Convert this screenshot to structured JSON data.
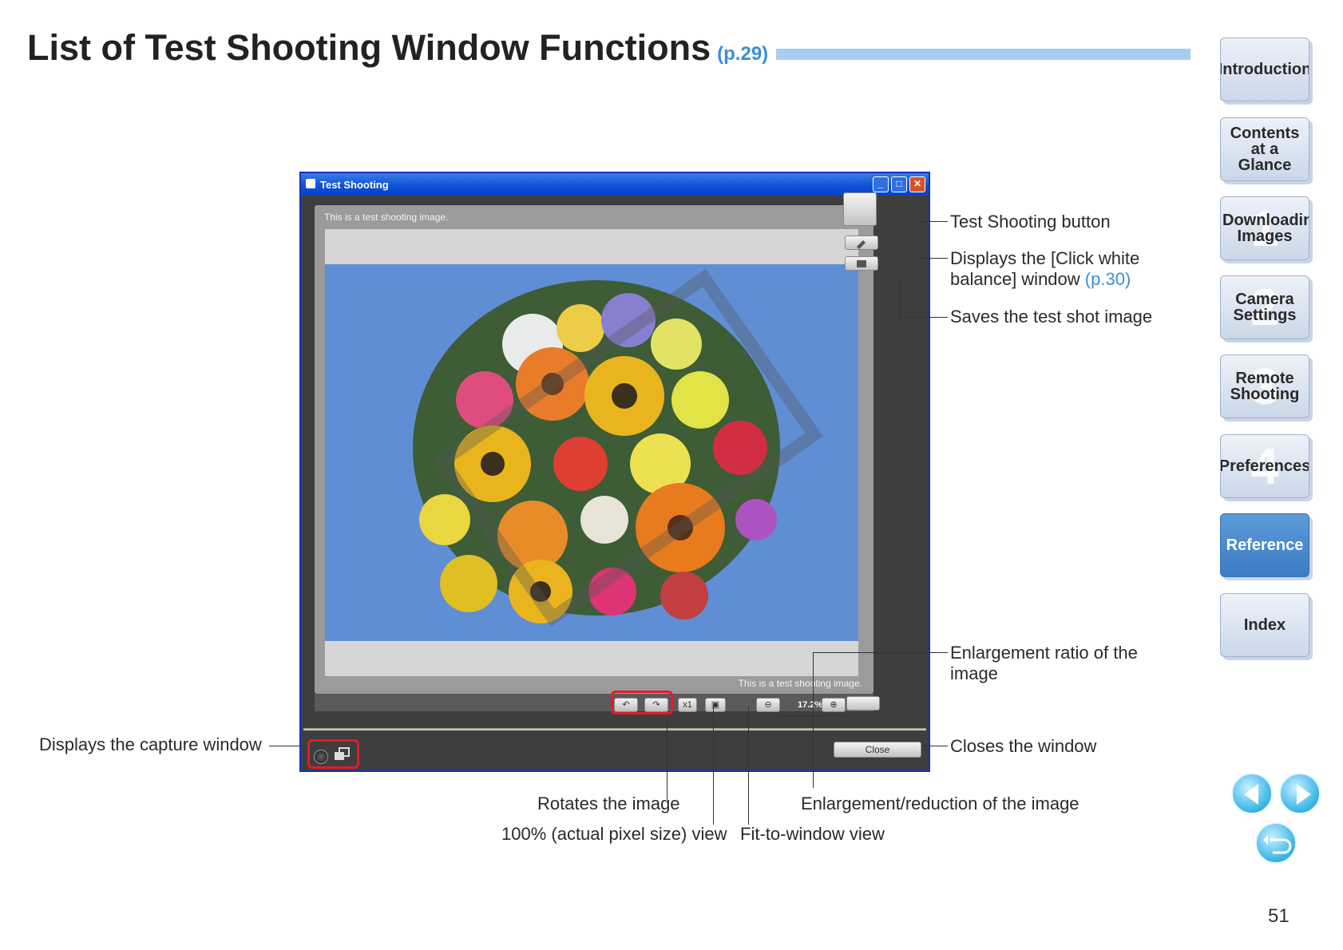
{
  "page": {
    "title": "List of Test Shooting Window Functions",
    "title_ref": "(p.29)",
    "page_number": "51"
  },
  "nav": {
    "items": [
      {
        "label": "Introduction",
        "num": ""
      },
      {
        "label": "Contents at a Glance",
        "num": ""
      },
      {
        "label": "Downloading Images",
        "num": "1"
      },
      {
        "label": "Camera Settings",
        "num": "2"
      },
      {
        "label": "Remote Shooting",
        "num": "3"
      },
      {
        "label": "Preferences",
        "num": "4"
      },
      {
        "label": "Reference",
        "num": ""
      },
      {
        "label": "Index",
        "num": ""
      }
    ],
    "active": "Reference"
  },
  "window": {
    "title": "Test Shooting",
    "caption_top": "This is a test shooting image.",
    "caption_bottom": "This is a test shooting image.",
    "zoom": "17.2%",
    "close_label": "Close",
    "actual_size_label": "x1"
  },
  "callouts": {
    "test_shooting_button": "Test Shooting button",
    "click_wb_line1": "Displays the [Click white",
    "click_wb_line2": "balance] window",
    "click_wb_ref": "(p.30)",
    "saves": "Saves the test shot image",
    "enlargement_ratio_line1": "Enlargement ratio of the",
    "enlargement_ratio_line2": "image",
    "closes": "Closes the window",
    "capture": "Displays the capture window",
    "rotates": "Rotates the image",
    "actual_pixel": "100% (actual pixel size) view",
    "fit_window": "Fit-to-window view",
    "enlarge_reduce": "Enlargement/reduction of the image"
  },
  "colors": {
    "accent": "#3b8fd8",
    "highlight": "#e01d2a",
    "nav_active": "#3b7cc4"
  },
  "icons": [
    "prev-page-icon",
    "next-page-icon",
    "return-icon",
    "rotate-left-icon",
    "rotate-right-icon",
    "zoom-out-icon",
    "zoom-in-icon",
    "fit-window-icon",
    "eyedropper-icon",
    "save-icon",
    "capture-window-icon"
  ]
}
